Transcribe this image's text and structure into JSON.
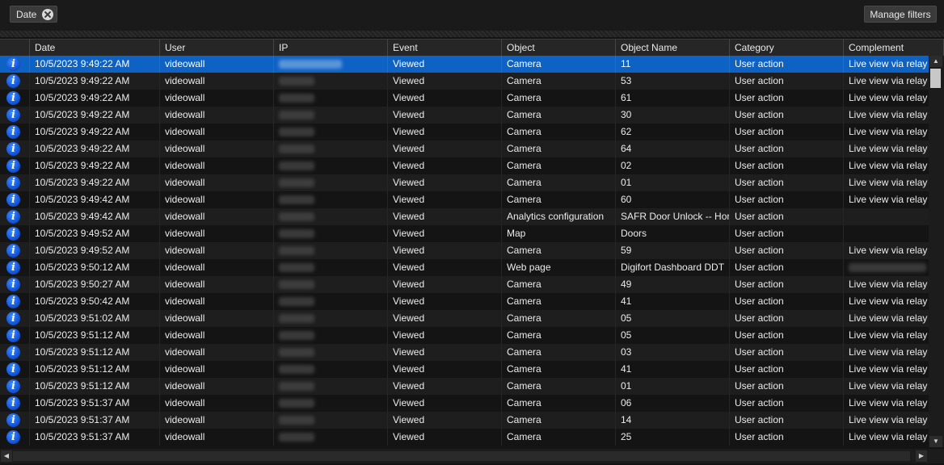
{
  "filter_bar": {
    "chip_label": "Date",
    "manage_label": "Manage filters"
  },
  "columns": [
    "",
    "Date",
    "User",
    "IP",
    "Event",
    "Object",
    "Object Name",
    "Category",
    "Complement"
  ],
  "rows": [
    {
      "date": "10/5/2023 9:49:22 AM",
      "user": "videowall",
      "event": "Viewed",
      "object": "Camera",
      "object_name": "11",
      "category": "User action",
      "complement": "Live view via relay",
      "selected": true
    },
    {
      "date": "10/5/2023 9:49:22 AM",
      "user": "videowall",
      "event": "Viewed",
      "object": "Camera",
      "object_name": "53",
      "category": "User action",
      "complement": "Live view via relay"
    },
    {
      "date": "10/5/2023 9:49:22 AM",
      "user": "videowall",
      "event": "Viewed",
      "object": "Camera",
      "object_name": "61",
      "category": "User action",
      "complement": "Live view via relay"
    },
    {
      "date": "10/5/2023 9:49:22 AM",
      "user": "videowall",
      "event": "Viewed",
      "object": "Camera",
      "object_name": "30",
      "category": "User action",
      "complement": "Live view via relay"
    },
    {
      "date": "10/5/2023 9:49:22 AM",
      "user": "videowall",
      "event": "Viewed",
      "object": "Camera",
      "object_name": "62",
      "category": "User action",
      "complement": "Live view via relay"
    },
    {
      "date": "10/5/2023 9:49:22 AM",
      "user": "videowall",
      "event": "Viewed",
      "object": "Camera",
      "object_name": "64",
      "category": "User action",
      "complement": "Live view via relay"
    },
    {
      "date": "10/5/2023 9:49:22 AM",
      "user": "videowall",
      "event": "Viewed",
      "object": "Camera",
      "object_name": "02",
      "category": "User action",
      "complement": "Live view via relay"
    },
    {
      "date": "10/5/2023 9:49:22 AM",
      "user": "videowall",
      "event": "Viewed",
      "object": "Camera",
      "object_name": "01",
      "category": "User action",
      "complement": "Live view via relay"
    },
    {
      "date": "10/5/2023 9:49:42 AM",
      "user": "videowall",
      "event": "Viewed",
      "object": "Camera",
      "object_name": "60",
      "category": "User action",
      "complement": "Live view via relay"
    },
    {
      "date": "10/5/2023 9:49:42 AM",
      "user": "videowall",
      "event": "Viewed",
      "object": "Analytics configuration",
      "object_name": "SAFR Door Unlock -- Hor",
      "category": "User action",
      "complement": ""
    },
    {
      "date": "10/5/2023 9:49:52 AM",
      "user": "videowall",
      "event": "Viewed",
      "object": "Map",
      "object_name": "Doors",
      "category": "User action",
      "complement": ""
    },
    {
      "date": "10/5/2023 9:49:52 AM",
      "user": "videowall",
      "event": "Viewed",
      "object": "Camera",
      "object_name": "59",
      "category": "User action",
      "complement": "Live view via relay"
    },
    {
      "date": "10/5/2023 9:50:12 AM",
      "user": "videowall",
      "event": "Viewed",
      "object": "Web page",
      "object_name": "Digifort Dashboard DDT",
      "category": "User action",
      "complement": "",
      "complement_blurred": true
    },
    {
      "date": "10/5/2023 9:50:27 AM",
      "user": "videowall",
      "event": "Viewed",
      "object": "Camera",
      "object_name": "49",
      "category": "User action",
      "complement": "Live view via relay"
    },
    {
      "date": "10/5/2023 9:50:42 AM",
      "user": "videowall",
      "event": "Viewed",
      "object": "Camera",
      "object_name": "41",
      "category": "User action",
      "complement": "Live view via relay"
    },
    {
      "date": "10/5/2023 9:51:02 AM",
      "user": "videowall",
      "event": "Viewed",
      "object": "Camera",
      "object_name": "05",
      "category": "User action",
      "complement": "Live view via relay"
    },
    {
      "date": "10/5/2023 9:51:12 AM",
      "user": "videowall",
      "event": "Viewed",
      "object": "Camera",
      "object_name": "05",
      "category": "User action",
      "complement": "Live view via relay"
    },
    {
      "date": "10/5/2023 9:51:12 AM",
      "user": "videowall",
      "event": "Viewed",
      "object": "Camera",
      "object_name": "03",
      "category": "User action",
      "complement": "Live view via relay"
    },
    {
      "date": "10/5/2023 9:51:12 AM",
      "user": "videowall",
      "event": "Viewed",
      "object": "Camera",
      "object_name": "41",
      "category": "User action",
      "complement": "Live view via relay"
    },
    {
      "date": "10/5/2023 9:51:12 AM",
      "user": "videowall",
      "event": "Viewed",
      "object": "Camera",
      "object_name": "01",
      "category": "User action",
      "complement": "Live view via relay"
    },
    {
      "date": "10/5/2023 9:51:37 AM",
      "user": "videowall",
      "event": "Viewed",
      "object": "Camera",
      "object_name": "06",
      "category": "User action",
      "complement": "Live view via relay"
    },
    {
      "date": "10/5/2023 9:51:37 AM",
      "user": "videowall",
      "event": "Viewed",
      "object": "Camera",
      "object_name": "14",
      "category": "User action",
      "complement": "Live view via relay"
    },
    {
      "date": "10/5/2023 9:51:37 AM",
      "user": "videowall",
      "event": "Viewed",
      "object": "Camera",
      "object_name": "25",
      "category": "User action",
      "complement": "Live view via relay"
    }
  ],
  "colors": {
    "selection": "#0e62c4",
    "info_icon": "#1456d8"
  },
  "icons": {
    "row_icon": "info-icon",
    "chip_remove": "close-icon"
  }
}
